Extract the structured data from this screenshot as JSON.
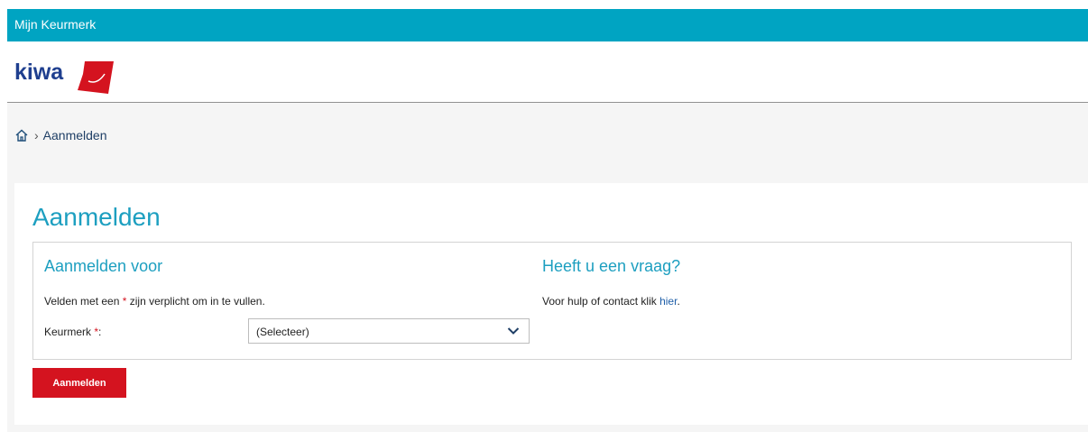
{
  "topbar": {
    "title": "Mijn Keurmerk"
  },
  "header": {
    "logo_text": "kiwa",
    "colors": {
      "logo_blue": "#1f3f8f",
      "logo_red": "#d4131f"
    }
  },
  "breadcrumb": {
    "home_icon": "home-icon",
    "separator": "›",
    "current": "Aanmelden"
  },
  "page": {
    "title": "Aanmelden",
    "form": {
      "section_title": "Aanmelden voor",
      "note_prefix": "Velden met een ",
      "note_star": "*",
      "note_suffix": " zijn verplicht om in te vullen.",
      "field_label": "Keurmerk ",
      "field_star": "*",
      "field_colon": ":",
      "select_value": "(Selecteer)"
    },
    "help": {
      "title": "Heeft u een vraag?",
      "text": "Voor hulp of contact klik ",
      "link": "hier",
      "punct": "."
    },
    "submit_label": "Aanmelden"
  },
  "colors": {
    "accent": "#00a4c2",
    "title": "#1d9fc0",
    "button": "#d4131f"
  }
}
